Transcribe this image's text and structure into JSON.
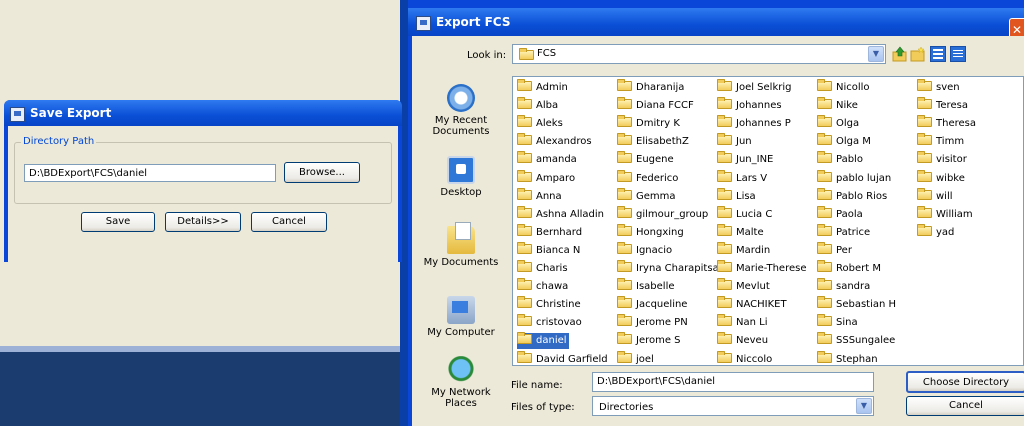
{
  "save_export": {
    "title": "Save Export",
    "group_label": "Directory Path",
    "path_value": "D:\\BDExport\\FCS\\daniel",
    "browse_label": "Browse...",
    "save_label": "Save",
    "details_label": "Details>>",
    "cancel_label": "Cancel"
  },
  "export_fcs": {
    "title": "Export FCS",
    "close_label": "✕",
    "look_in_label": "Look in:",
    "look_in_value": "FCS",
    "places": [
      {
        "label": "My Recent Documents",
        "icon": "recent-documents-icon"
      },
      {
        "label": "Desktop",
        "icon": "desktop-icon"
      },
      {
        "label": "My Documents",
        "icon": "my-documents-icon"
      },
      {
        "label": "My Computer",
        "icon": "my-computer-icon"
      },
      {
        "label": "My Network Places",
        "icon": "network-places-icon"
      }
    ],
    "folders": [
      [
        "Admin",
        "Alba",
        "Aleks",
        "Alexandros",
        "amanda",
        "Amparo",
        "Anna",
        "Ashna Alladin",
        "Bernhard",
        "Bianca N",
        "Charis",
        "chawa",
        "Christine",
        "cristovao",
        "daniel",
        "David Garfield"
      ],
      [
        "Dharanija",
        "Diana FCCF",
        "Dmitry K",
        "ElisabethZ",
        "Eugene",
        "Federico",
        "Gemma",
        "gilmour_group",
        "Hongxing",
        "Ignacio",
        "Iryna Charapitsa",
        "Isabelle",
        "Jacqueline",
        "Jerome PN",
        "Jerome S",
        "joel"
      ],
      [
        "Joel Selkrig",
        "Johannes",
        "Johannes P",
        "Jun",
        "Jun_INE",
        "Lars V",
        "Lisa",
        "Lucia C",
        "Malte",
        "Mardin",
        "Marie-Therese",
        "Mevlut",
        "NACHIKET",
        "Nan Li",
        "Neveu",
        "Niccolo"
      ],
      [
        "Nicollo",
        "Nike",
        "Olga",
        "Olga M",
        "Pablo",
        "pablo lujan",
        "Pablo Rios",
        "Paola",
        "Patrice",
        "Per",
        "Robert M",
        "sandra",
        "Sebastian H",
        "Sina",
        "SSSungalee",
        "Stephan"
      ],
      [
        "sven",
        "Teresa",
        "Theresa",
        "Timm",
        "visitor",
        "wibke",
        "will",
        "William",
        "yad"
      ]
    ],
    "selected_folder": "daniel",
    "file_name_label": "File name:",
    "file_name_value": "D:\\BDExport\\FCS\\daniel",
    "files_of_type_label": "Files of type:",
    "files_of_type_value": "Directories",
    "choose_label": "Choose Directory",
    "cancel_label": "Cancel"
  }
}
